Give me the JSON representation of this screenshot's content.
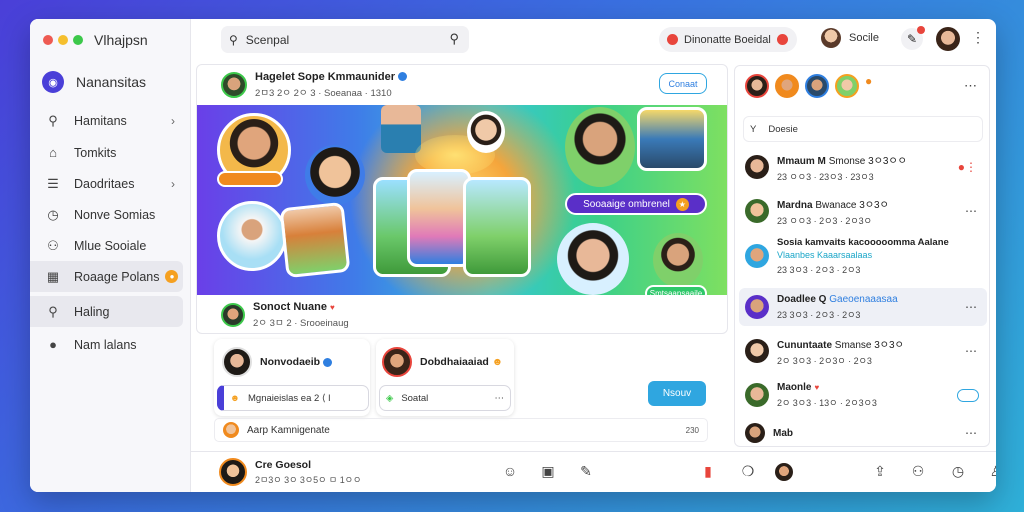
{
  "window": {
    "app_title": "Vlhajpsn",
    "brand_label": "Nanansitas",
    "traffic_colors": [
      "#ee5a52",
      "#f5bf2e",
      "#3cc84a"
    ]
  },
  "sidebar": {
    "items": [
      {
        "label": "Hamitans",
        "icon": "search-icon",
        "chevron": "›"
      },
      {
        "label": "Tomkits",
        "icon": "home-icon"
      },
      {
        "label": "Daodritaes",
        "icon": "list-icon",
        "chevron": "›"
      },
      {
        "label": "Nonve Somias",
        "icon": "clock-icon"
      },
      {
        "label": "Mlue Sooiale",
        "icon": "people-icon"
      },
      {
        "label": "Roaage Polans",
        "icon": "grid-icon",
        "badge": "●"
      },
      {
        "label": "Haling",
        "icon": "search-icon"
      },
      {
        "label": "Nam lalans",
        "icon": "chat-icon"
      }
    ]
  },
  "topbar": {
    "search_placeholder": "Scenpal",
    "pill_label": "Dinonatte Boeidal",
    "user_label": "Socile"
  },
  "post": {
    "author": "Hagelet Sope Kmmaunider",
    "meta": "2ㅁ3 2ㅇ 2ㅇ 3 · Soeanaa · 1310",
    "follow_label": "Conaat",
    "cta_label": "Sooaaige ombrenel",
    "green_label": "Smtsaansaaile",
    "footer_name": "Sonoct Nuane",
    "footer_meta": "2ㅇ 3ㅁ 2 · Srooeinaug"
  },
  "comments": [
    {
      "name": "Nonvodaeib",
      "input": "Mgnaieislas ea 2 ⟨ l"
    },
    {
      "name": "Dobdhaiaaiad",
      "input": "Soatal"
    }
  ],
  "send_label": "Nsouv",
  "add_row": {
    "label": "Aarp Kamnigenate",
    "count": "230"
  },
  "bottom": {
    "name": "Cre Goesol",
    "meta": "2ㅁ3ㅇ 3ㅇ 3ㅇ5ㅇ ㅁ 1ㅇㅇ"
  },
  "rpanel": {
    "search_placeholder": "Doesie",
    "messages": [
      {
        "name": "Mmaum M",
        "tag": "Smonse 3ㅇ3ㅇㅇ",
        "meta": "23 ㅇㅇ3 · 23ㅇ3 · 23ㅇ3"
      },
      {
        "name": "Mardna",
        "tag": "Bwanace 3ㅇ3ㅇ",
        "meta": "23 ㅇㅇ3 · 2ㅇ3 · 2ㅇ3ㅇ"
      },
      {
        "name": "Sosia kamvaits kacooooomma Aalane",
        "tag": "Vlaanbes Kaaarsaalaas",
        "meta": "23 3ㅇ3 · 2ㅇ3 · 2ㅇ3"
      },
      {
        "name": "Doadlee Q",
        "tag": "Gaeoenaaasaa",
        "meta": "23 3ㅇ3 · 2ㅇ3 · 2ㅇ3"
      },
      {
        "name": "Cununtaate",
        "tag": "Smanse 3ㅇ3ㅇ",
        "meta": "2ㅇ 3ㅇ3 · 2ㅇ3ㅇ · 2ㅇ3"
      },
      {
        "name": "Maonle",
        "tag": "",
        "meta": "2ㅇ 3ㅇ3 · 13ㅇ · 2ㅇ3ㅇ3"
      },
      {
        "name": "Mab",
        "tag": "",
        "meta": ""
      }
    ]
  },
  "colors": {
    "accent": "#4a3fd8",
    "blue": "#2fa6e0",
    "green": "#2fc86a",
    "orange": "#f08a1e",
    "red": "#e8453c"
  }
}
